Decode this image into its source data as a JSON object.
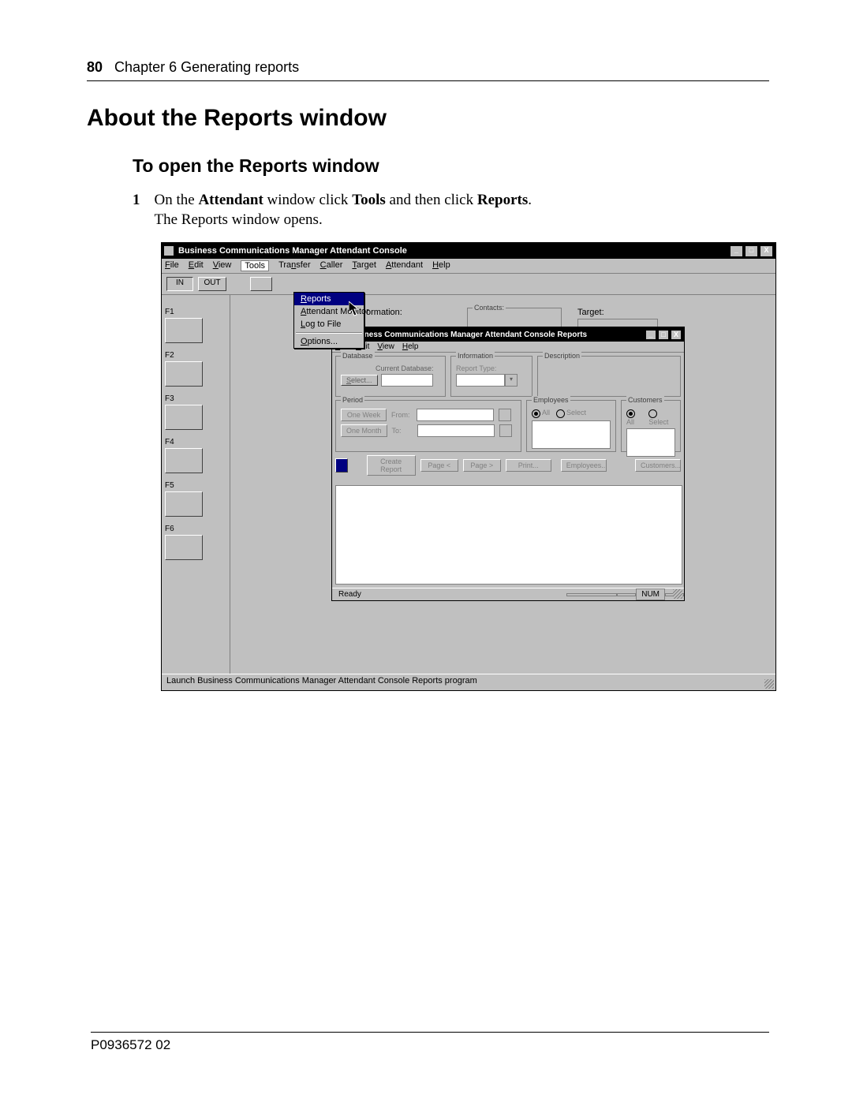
{
  "page": {
    "page_number": "80",
    "chapter_header": "Chapter 6  Generating reports",
    "title_h1": "About the Reports window",
    "title_h2": "To open the Reports window",
    "step_num": "1",
    "step_text_pre": "On the ",
    "step_b1": "Attendant",
    "step_text_mid": " window click ",
    "step_b2": "Tools",
    "step_text_mid2": " and then click ",
    "step_b3": "Reports",
    "step_text_end": ".",
    "step_line2": "The Reports window opens.",
    "footer": "P0936572 02"
  },
  "mainwin": {
    "title": "Business Communications Manager Attendant Console",
    "menus": [
      "File",
      "Edit",
      "View",
      "Tools",
      "Transfer",
      "Caller",
      "Target",
      "Attendant",
      "Help"
    ],
    "toolbar": {
      "in": "IN",
      "out": "OUT"
    },
    "fkeys": [
      "F1",
      "F2",
      "F3",
      "F4",
      "F5",
      "F6"
    ],
    "toolsmenu": {
      "reports": "Reports",
      "monitor": "Attendant Monitor",
      "logfile": "Log to File",
      "options": "Options..."
    },
    "info": {
      "information": "ormation:",
      "contacts": "Contacts:",
      "target": "Target:"
    },
    "statusbar": "Launch Business Communications Manager Attendant Console Reports program"
  },
  "reports": {
    "title": "Business Communications Manager Attendant Console Reports",
    "menus": [
      "File",
      "Edit",
      "View",
      "Help"
    ],
    "groups": {
      "database": "Database",
      "information": "Information",
      "period": "Period",
      "employees": "Employees",
      "customers": "Customers",
      "description": "Description"
    },
    "labels": {
      "current_db": "Current Database:",
      "report_type": "Report Type:",
      "select": "Select...",
      "one_week": "One Week",
      "one_month": "One Month",
      "from": "From:",
      "to": "To:",
      "all": "All",
      "select_radio": "Select",
      "employees_btn": "Employees...",
      "customers_btn": "Customers...",
      "create_report": "Create Report",
      "page_lt": "Page <",
      "page_gt": "Page >",
      "print": "Print..."
    },
    "status": {
      "ready": "Ready",
      "num": "NUM"
    }
  }
}
